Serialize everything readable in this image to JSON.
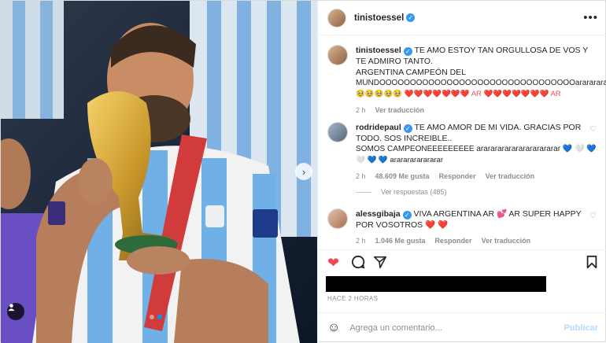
{
  "header": {
    "username": "tinistoessel",
    "more_icon": "more-icon"
  },
  "comments": [
    {
      "username": "tinistoessel",
      "text": "TE AMO ESTOY TAN ORGULLOSA DE VOS Y TE ADMIRO TANTO.",
      "line2": "ARGENTINA CAMPEÓN DEL",
      "line3": "MUNDOOOOOOOOOOOOOOOOOOOOOOOOOOOOOOOOarararararararar 🥹",
      "emojis": "🥹🥹🥹🥹🥹 ❤️❤️❤️❤️❤️❤️❤️ AR ❤️❤️❤️❤️❤️❤️❤️ AR",
      "time": "2 h",
      "reply": "Ver traducción"
    },
    {
      "username": "rodridepaul",
      "text": "TE AMO AMOR DE MI VIDA. GRACIAS POR TODO. SOS INCREIBLE..",
      "line2": "SOMOS CAMPEONEEEEEEEEE arararararararararararar 💙 🤍 💙",
      "line3": "🤍 💙 💙 arararararararar",
      "time": "2 h",
      "likes": "48.609 Me gusta",
      "reply": "Responder",
      "translate": "Ver traducción"
    },
    {
      "username": "alessgibaja",
      "text": "VIVA ARGENTINA AR 💕 AR SUPER HAPPY POR VOSOTROS ❤️ ❤️",
      "time": "2 h",
      "likes": "1.046 Me gusta",
      "reply": "Responder",
      "translate": "Ver traducción"
    }
  ],
  "view_replies": "Ver respuestas (485)",
  "timestamp": "HACE 2 HORAS",
  "add_comment": {
    "placeholder": "Agrega un comentario...",
    "publish": "Publicar"
  },
  "colors": {
    "like": "#ed4956",
    "link_disabled": "#b3dbff",
    "verified": "#3897f0"
  }
}
